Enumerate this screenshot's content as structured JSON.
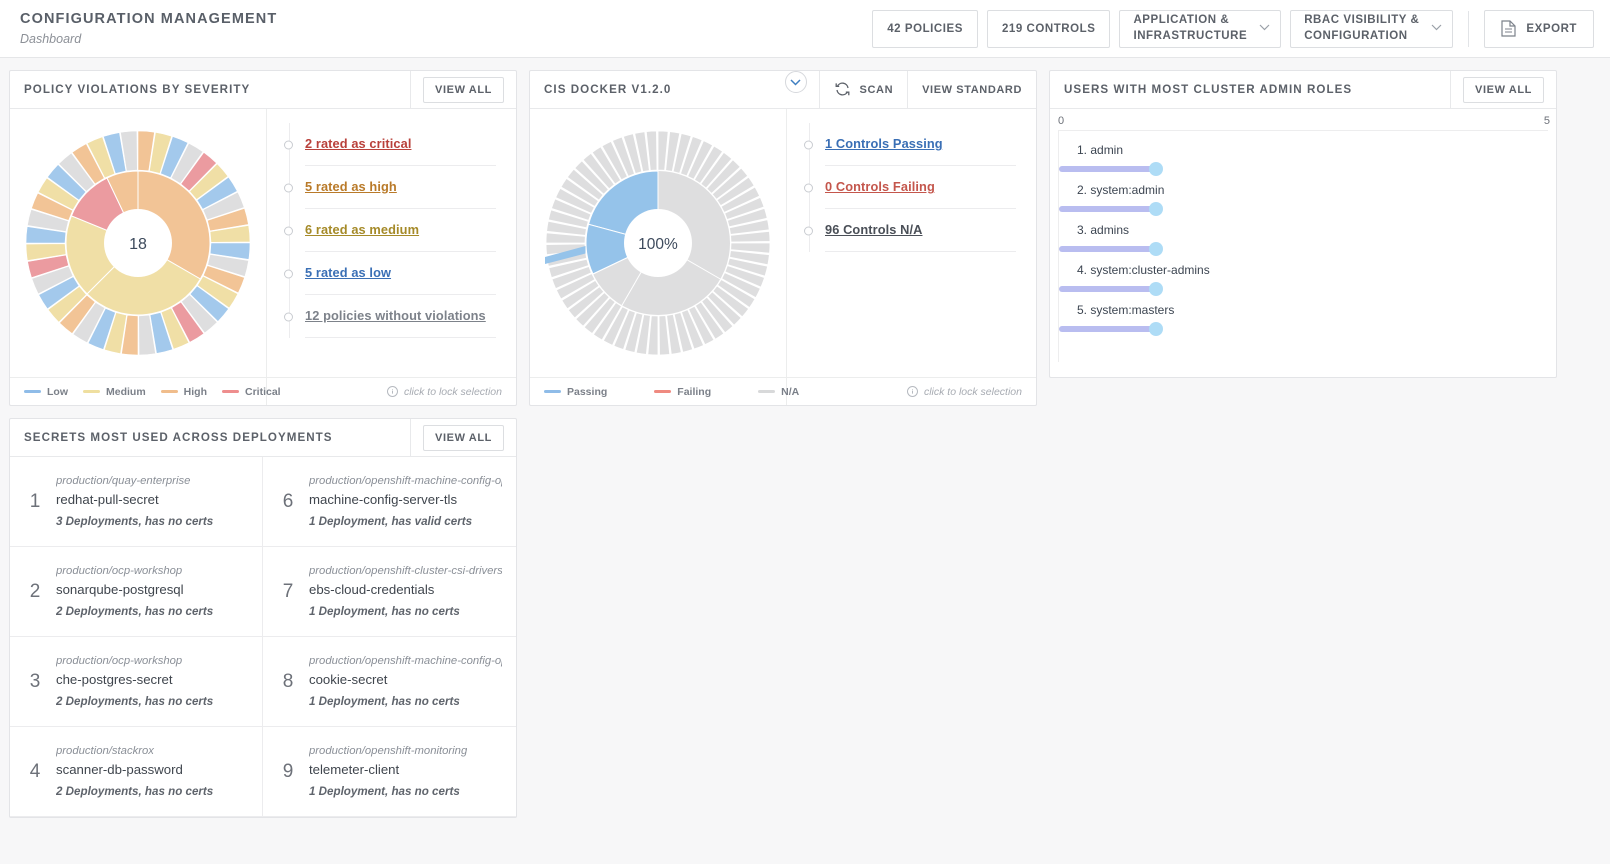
{
  "header": {
    "title": "CONFIGURATION MANAGEMENT",
    "subtitle": "Dashboard",
    "policies_button": "42 POLICIES",
    "controls_button": "219 CONTROLS",
    "app_infra_line1": "APPLICATION &",
    "app_infra_line2": "INFRASTRUCTURE",
    "rbac_line1": "RBAC VISIBILITY &",
    "rbac_line2": "CONFIGURATION",
    "export_button": "EXPORT"
  },
  "policy_card": {
    "title": "POLICY VIOLATIONS BY SEVERITY",
    "view_all": "VIEW ALL",
    "center_value": "18",
    "items": [
      {
        "label": "2 rated as critical",
        "color": "#b9413b"
      },
      {
        "label": "5 rated as high",
        "color": "#b97a29"
      },
      {
        "label": "6 rated as medium",
        "color": "#a58a28"
      },
      {
        "label": "5 rated as low",
        "color": "#3a6fb5"
      },
      {
        "label": "12 policies without violations",
        "color": "#7d828a"
      }
    ],
    "legend": [
      {
        "label": "Low",
        "color": "#8fbce8"
      },
      {
        "label": "Medium",
        "color": "#efdfa0"
      },
      {
        "label": "High",
        "color": "#f0bd8c"
      },
      {
        "label": "Critical",
        "color": "#ee8e8e"
      }
    ],
    "lock_note": "click to lock selection"
  },
  "cis_card": {
    "title": "CIS DOCKER V1.2.0",
    "scan_button": "SCAN",
    "view_standard_button": "VIEW STANDARD",
    "center_value": "100%",
    "items": [
      {
        "label": "1 Controls Passing",
        "color": "#3a6fb5"
      },
      {
        "label": "0 Controls Failing",
        "color": "#c4564c"
      },
      {
        "label": "96 Controls N/A",
        "color": "#4a4f57"
      }
    ],
    "legend": [
      {
        "label": "Passing",
        "color": "#8fbce8"
      },
      {
        "label": "Failing",
        "color": "#ef8a80"
      },
      {
        "label": "N/A",
        "color": "#d8d9da"
      }
    ],
    "lock_note": "click to lock selection"
  },
  "admins_card": {
    "title": "USERS WITH MOST CLUSTER ADMIN ROLES",
    "view_all": "VIEW ALL",
    "axis_min": "0",
    "axis_max": "5"
  },
  "secrets_card": {
    "title": "SECRETS MOST USED ACROSS DEPLOYMENTS",
    "view_all": "VIEW ALL",
    "rows": [
      {
        "rank": "1",
        "namespace": "production/quay-enterprise",
        "name": "redhat-pull-secret",
        "meta": "3 Deployments, has no certs"
      },
      {
        "rank": "6",
        "namespace": "production/openshift-machine-config-operator",
        "name": "machine-config-server-tls",
        "meta": "1 Deployment, has valid certs"
      },
      {
        "rank": "2",
        "namespace": "production/ocp-workshop",
        "name": "sonarqube-postgresql",
        "meta": "2 Deployments, has no certs"
      },
      {
        "rank": "7",
        "namespace": "production/openshift-cluster-csi-drivers",
        "name": "ebs-cloud-credentials",
        "meta": "1 Deployment, has no certs"
      },
      {
        "rank": "3",
        "namespace": "production/ocp-workshop",
        "name": "che-postgres-secret",
        "meta": "2 Deployments, has no certs"
      },
      {
        "rank": "8",
        "namespace": "production/openshift-machine-config-operator",
        "name": "cookie-secret",
        "meta": "1 Deployment, has no certs"
      },
      {
        "rank": "4",
        "namespace": "production/stackrox",
        "name": "scanner-db-password",
        "meta": "2 Deployments, has no certs"
      },
      {
        "rank": "9",
        "namespace": "production/openshift-monitoring",
        "name": "telemeter-client",
        "meta": "1 Deployment, has no certs"
      }
    ]
  },
  "chart_data": [
    {
      "type": "pie",
      "title": "Policy violations by severity",
      "center_label": "18",
      "legend_position": "bottom",
      "rings": 2,
      "categories": [
        "Low",
        "Medium",
        "High",
        "Critical"
      ],
      "colors": [
        "#8fbce8",
        "#efdfa0",
        "#f0bd8c",
        "#ee8e8e"
      ],
      "inner_ring": [
        {
          "name": "High",
          "value": 6,
          "color": "#f0bd8c"
        },
        {
          "name": "Medium",
          "value": 6,
          "color": "#efdfa0"
        },
        {
          "name": "Critical",
          "value": 2,
          "color": "#ee8e8e"
        }
      ],
      "outer_counts": {
        "critical": 2,
        "high": 5,
        "medium": 6,
        "low": 5,
        "without_violations": 12
      }
    },
    {
      "type": "pie",
      "title": "CIS Docker v1.2.0",
      "center_label": "100%",
      "legend_position": "bottom",
      "rings": 2,
      "categories": [
        "Passing",
        "Failing",
        "N/A"
      ],
      "colors": [
        "#8fbce8",
        "#ef8a80",
        "#d8d9da"
      ],
      "values": [
        1,
        0,
        96
      ],
      "inner_ring": [
        {
          "name": "Passing",
          "value": 1,
          "color": "#8fbce8"
        },
        {
          "name": "N/A",
          "value": 96,
          "color": "#d8d9da"
        }
      ]
    },
    {
      "type": "bar",
      "title": "Users with most cluster admin roles",
      "orientation": "horizontal",
      "style": "lollipop",
      "xlabel": "",
      "ylabel": "",
      "xlim": [
        0,
        5
      ],
      "grid": false,
      "categories": [
        "1. admin",
        "2. system:admin",
        "3. admins",
        "4. system:cluster-admins",
        "5. system:masters"
      ],
      "values": [
        1,
        1,
        1,
        1,
        1
      ],
      "bar_color": "#b9bdf0",
      "dot_color": "#aedcf6"
    }
  ]
}
